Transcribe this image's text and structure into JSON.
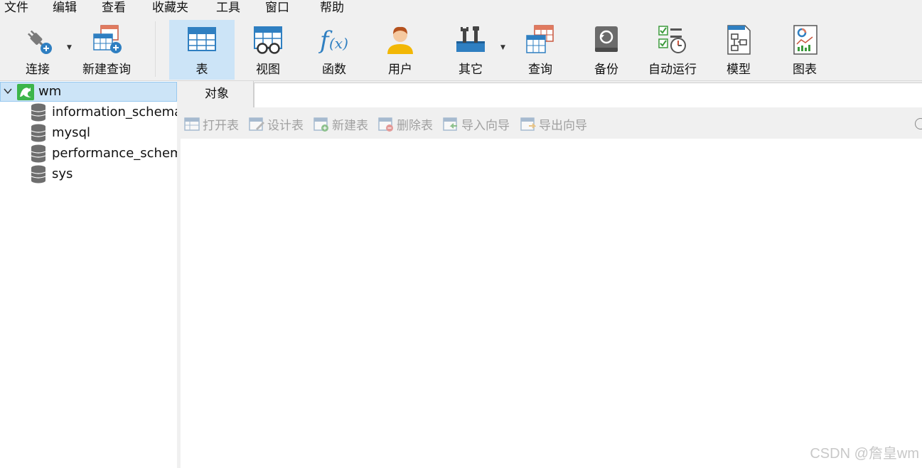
{
  "menu": {
    "items": [
      "文件",
      "编辑",
      "查看",
      "收藏夹",
      "工具",
      "窗口",
      "帮助"
    ]
  },
  "toolbar": {
    "connect": "连接",
    "new_query": "新建查询",
    "table": "表",
    "view": "视图",
    "function": "函数",
    "user": "用户",
    "other": "其它",
    "query": "查询",
    "backup": "备份",
    "automation": "自动运行",
    "model": "模型",
    "chart": "图表"
  },
  "tree": {
    "connection": "wm",
    "databases": [
      "information_schema",
      "mysql",
      "performance_schema",
      "sys"
    ]
  },
  "tabs": {
    "objects": "对象"
  },
  "object_toolbar": {
    "open_table": "打开表",
    "design_table": "设计表",
    "new_table": "新建表",
    "delete_table": "删除表",
    "import_wizard": "导入向导",
    "export_wizard": "导出向导"
  },
  "watermark": "CSDN @詹皇wm",
  "colors": {
    "active_tab_bg": "#cce4f7",
    "toolbar_bg": "#f0f0f0",
    "accent_blue": "#2f7fc1",
    "connection_green": "#3cb54a"
  }
}
